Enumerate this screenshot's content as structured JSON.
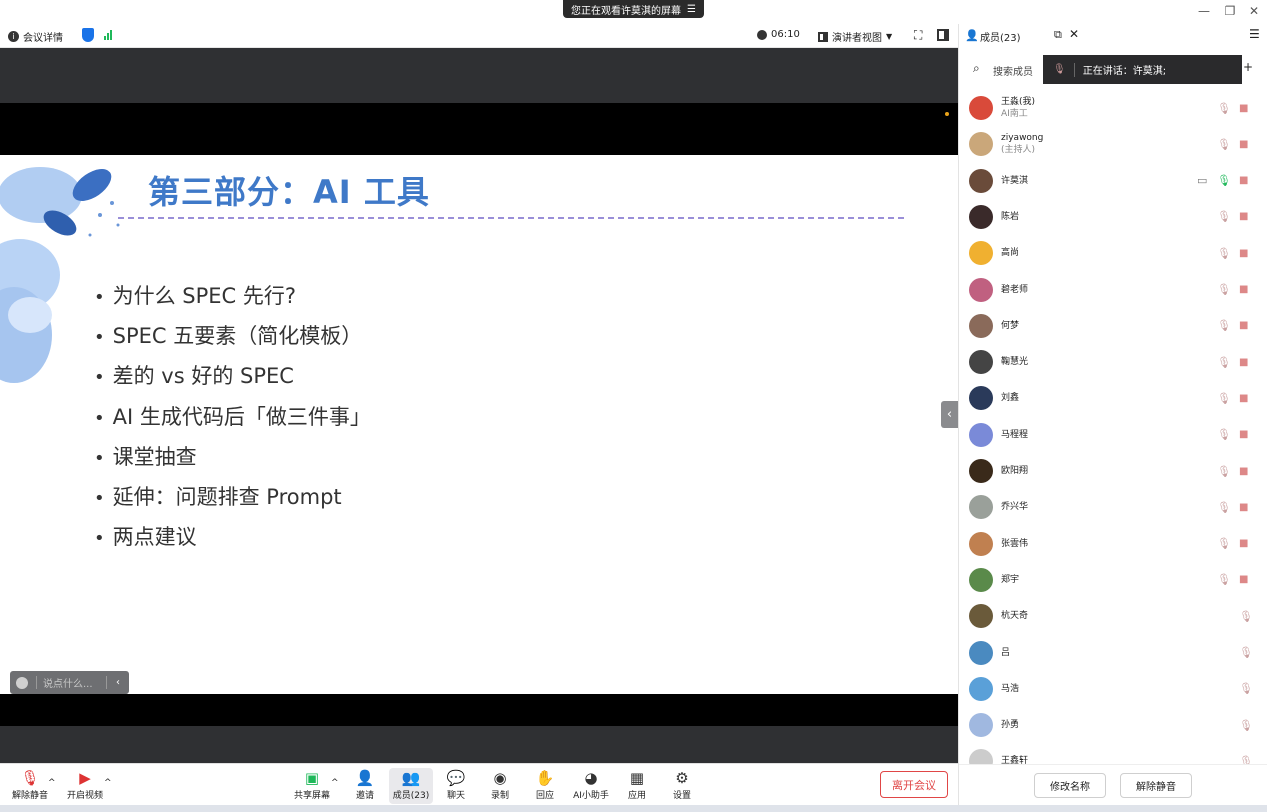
{
  "window": {
    "viewing_banner": "您正在观看许莫淇的屏幕",
    "banner_icon": "list-icon",
    "controls": [
      "minimize-icon",
      "restore-icon",
      "close-icon"
    ]
  },
  "infobar": {
    "meeting_details": "会议详情",
    "timer": "06:10",
    "view_mode": "演讲者视图",
    "security_color": "#1a73e8",
    "signal_color": "#1fb85a"
  },
  "slide": {
    "title": "第三部分：AI 工具",
    "bullets": [
      "为什么 SPEC 先行?",
      "SPEC 五要素（简化模板）",
      "差的 vs 好的 SPEC",
      "AI 生成代码后「做三件事」",
      "课堂抽查",
      "延伸：问题排查 Prompt",
      "两点建议"
    ],
    "title_color": "#3f79c8"
  },
  "chat": {
    "placeholder": "说点什么..."
  },
  "toolbar": {
    "unmute": "解除静音",
    "start_video": "开启视频",
    "share_screen": "共享屏幕",
    "invite": "邀请",
    "members": "成员(23)",
    "chat": "聊天",
    "record": "录制",
    "react": "回应",
    "ai_assistant": "AI小助手",
    "apps": "应用",
    "settings": "设置",
    "leave": "离开会议",
    "leave_color": "#e04646"
  },
  "panel": {
    "title": "成员(23)",
    "search_label": "搜索成员",
    "speaking": "正在讲话：许莫淇;",
    "members": [
      {
        "name": "王淼(我)",
        "sub": "AI南工",
        "mic": true,
        "cam": true
      },
      {
        "name": "ziyawong",
        "sub": "(主持人)",
        "mic": true,
        "cam": true
      },
      {
        "name": "许莫淇",
        "sub": "",
        "mic": true,
        "cam": true,
        "sharing": true,
        "mic_active": true
      },
      {
        "name": "陈岩",
        "sub": "",
        "mic": true,
        "cam": true
      },
      {
        "name": "高尚",
        "sub": "",
        "mic": true,
        "cam": true
      },
      {
        "name": "碧老师",
        "sub": "",
        "mic": true,
        "cam": true
      },
      {
        "name": "何梦",
        "sub": "",
        "mic": true,
        "cam": true
      },
      {
        "name": "鞠慧光",
        "sub": "",
        "mic": true,
        "cam": true
      },
      {
        "name": "刘鑫",
        "sub": "",
        "mic": true,
        "cam": true
      },
      {
        "name": "马程程",
        "sub": "",
        "mic": true,
        "cam": true
      },
      {
        "name": "欧阳翔",
        "sub": "",
        "mic": true,
        "cam": true
      },
      {
        "name": "乔兴华",
        "sub": "",
        "mic": true,
        "cam": true
      },
      {
        "name": "张雲伟",
        "sub": "",
        "mic": true,
        "cam": true
      },
      {
        "name": "郑宇",
        "sub": "",
        "mic": true,
        "cam": true
      },
      {
        "name": "杭天奇",
        "sub": "",
        "mic": true,
        "cam": false
      },
      {
        "name": "吕",
        "sub": "",
        "mic": true,
        "cam": false
      },
      {
        "name": "马浩",
        "sub": "",
        "mic": true,
        "cam": false
      },
      {
        "name": "孙勇",
        "sub": "",
        "mic": true,
        "cam": false
      },
      {
        "name": "王鑫轩",
        "sub": "",
        "mic": true,
        "cam": false
      }
    ],
    "rename": "修改名称",
    "unmute_all": "解除静音"
  }
}
